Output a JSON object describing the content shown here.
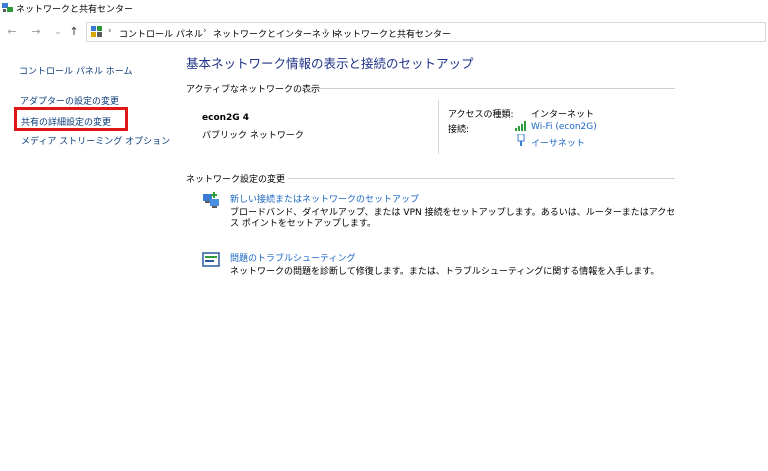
{
  "window": {
    "title": "ネットワークと共有センター"
  },
  "address": {
    "crumbs": [
      "コントロール パネル",
      "ネットワークとインターネット",
      "ネットワークと共有センター"
    ],
    "separator": "›"
  },
  "nav": {
    "back": "←",
    "forward": "→",
    "dropdown": "⌄",
    "up": "↑"
  },
  "sidebar": {
    "home": "コントロール パネル ホーム",
    "items": [
      "アダプターの設定の変更",
      "共有の詳細設定の変更",
      "メディア ストリーミング オプション"
    ]
  },
  "main": {
    "heading": "基本ネットワーク情報の表示と接続のセットアップ",
    "active_section": "アクティブなネットワークの表示",
    "network": {
      "name": "econ2G 4",
      "category": "パブリック ネットワーク",
      "access_label": "アクセスの種類:",
      "access_value": "インターネット",
      "conn_label": "接続:",
      "connections": [
        "Wi-Fi (econ2G)",
        "イーサネット"
      ]
    },
    "change_section": "ネットワーク設定の変更",
    "tasks": [
      {
        "title": "新しい接続またはネットワークのセットアップ",
        "desc": "ブロードバンド、ダイヤルアップ、または VPN 接続をセットアップします。あるいは、ルーターまたはアクセス ポイントをセットアップします。"
      },
      {
        "title": "問題のトラブルシューティング",
        "desc": "ネットワークの問題を診断して修復します。または、トラブルシューティングに関する情報を入手します。"
      }
    ]
  },
  "colors": {
    "heading": "#1e3287",
    "link": "#1a66c4",
    "highlight": "#e01515"
  }
}
